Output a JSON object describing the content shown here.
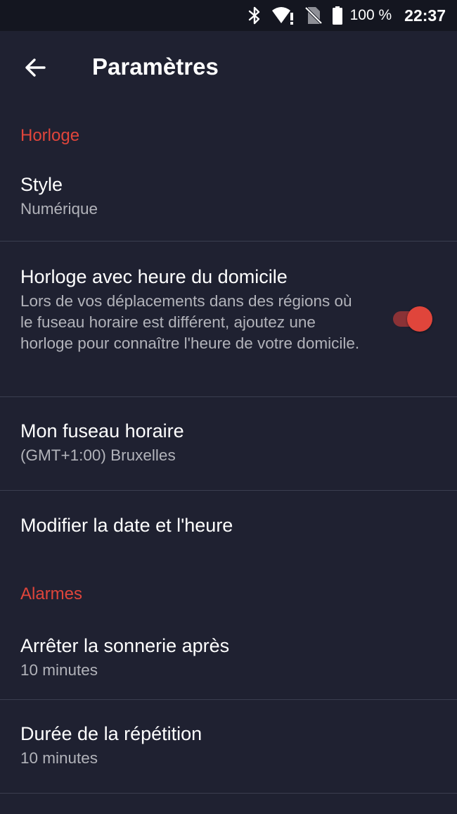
{
  "status_bar": {
    "icons": [
      "bluetooth-icon",
      "wifi-alert-icon",
      "no-sim-icon",
      "battery-full-icon"
    ],
    "battery": "100 %",
    "time": "22:37"
  },
  "app_bar": {
    "back_icon": "arrow-left-icon",
    "title": "Paramètres"
  },
  "sections": {
    "clock": {
      "header": "Horloge",
      "style": {
        "title": "Style",
        "summary": "Numérique"
      },
      "home_clock": {
        "title": "Horloge avec heure du domicile",
        "summary": "Lors de vos déplacements dans des régions où le fuseau horaire est différent, ajoutez une horloge pour connaître l'heure de votre domicile.",
        "enabled": true
      },
      "timezone": {
        "title": "Mon fuseau horaire",
        "summary": "(GMT+1:00) Bruxelles"
      },
      "date_time": {
        "title": "Modifier la date et l'heure"
      }
    },
    "alarms": {
      "header": "Alarmes",
      "silence_after": {
        "title": "Arrêter la sonnerie après",
        "summary": "10 minutes"
      },
      "snooze_length": {
        "title": "Durée de la répétition",
        "summary": "10 minutes"
      }
    }
  },
  "colors": {
    "background": "#1f2131",
    "status_bar": "#141620",
    "accent": "#e0453b",
    "divider": "#3b3e4f"
  }
}
